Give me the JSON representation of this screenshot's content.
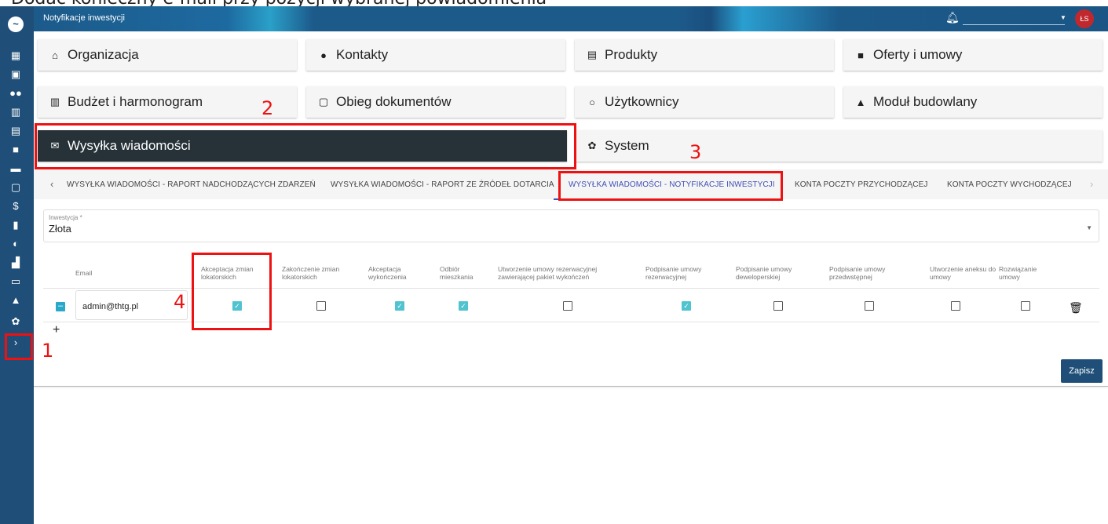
{
  "caption": "Dodać konieczny e-mail przy pozycji wybranej powiadomienia",
  "topbar": {
    "title": "Notyfikacje inwestycji",
    "avatar": "ŁS"
  },
  "modules": [
    {
      "label": "Organizacja",
      "icon": "home-icon"
    },
    {
      "label": "Kontakty",
      "icon": "person-icon"
    },
    {
      "label": "Produkty",
      "icon": "store-icon"
    },
    {
      "label": "Oferty i umowy",
      "icon": "folder-icon"
    },
    {
      "label": "Budżet i harmonogram",
      "icon": "building-icon"
    },
    {
      "label": "Obieg dokumentów",
      "icon": "inbox-icon"
    },
    {
      "label": "Użytkownicy",
      "icon": "user-outline-icon"
    },
    {
      "label": "Moduł budowlany",
      "icon": "warning-icon"
    },
    {
      "label": "Wysyłka wiadomości",
      "icon": "mail-icon"
    },
    {
      "label": "System",
      "icon": "gear-icon"
    }
  ],
  "annotations": [
    "1",
    "2",
    "3",
    "4"
  ],
  "tabs": [
    "WYSYŁKA WIADOMOŚCI - RAPORT NADCHODZĄCYCH ZDARZEŃ",
    "WYSYŁKA WIADOMOŚCI - RAPORT ZE ŹRÓDEŁ DOTARCIA",
    "WYSYŁKA WIADOMOŚCI - NOTYFIKACJE INWESTYCJI",
    "KONTA POCZTY PRZYCHODZĄCEJ",
    "KONTA POCZTY WYCHODZĄCEJ"
  ],
  "investment": {
    "label": "Inwestycja *",
    "value": "Złota"
  },
  "table": {
    "email_header": "Email",
    "columns": [
      [
        "Akceptacja zmian",
        "lokatorskich"
      ],
      [
        "Zakończenie zmian",
        "lokatorskich"
      ],
      [
        "Akceptacja",
        "wykończenia"
      ],
      [
        "Odbiór",
        "mieszkania"
      ],
      [
        "Utworzenie umowy rezerwacyjnej",
        "zawierającej pakiet wykończeń"
      ],
      [
        "Podpisanie umowy",
        "rezerwacyjnej"
      ],
      [
        "Podpisanie umowy",
        "deweloperskiej"
      ],
      [
        "Podpisanie umowy",
        "przedwstępnej"
      ],
      [
        "Utworzenie aneksu do",
        "umowy"
      ],
      [
        "Rozwiązanie",
        "umowy"
      ]
    ],
    "rows": [
      {
        "email": "admin@thtg.pl",
        "checks": [
          true,
          false,
          true,
          true,
          false,
          true,
          false,
          false,
          false,
          false
        ]
      }
    ]
  },
  "save_label": "Zapisz"
}
